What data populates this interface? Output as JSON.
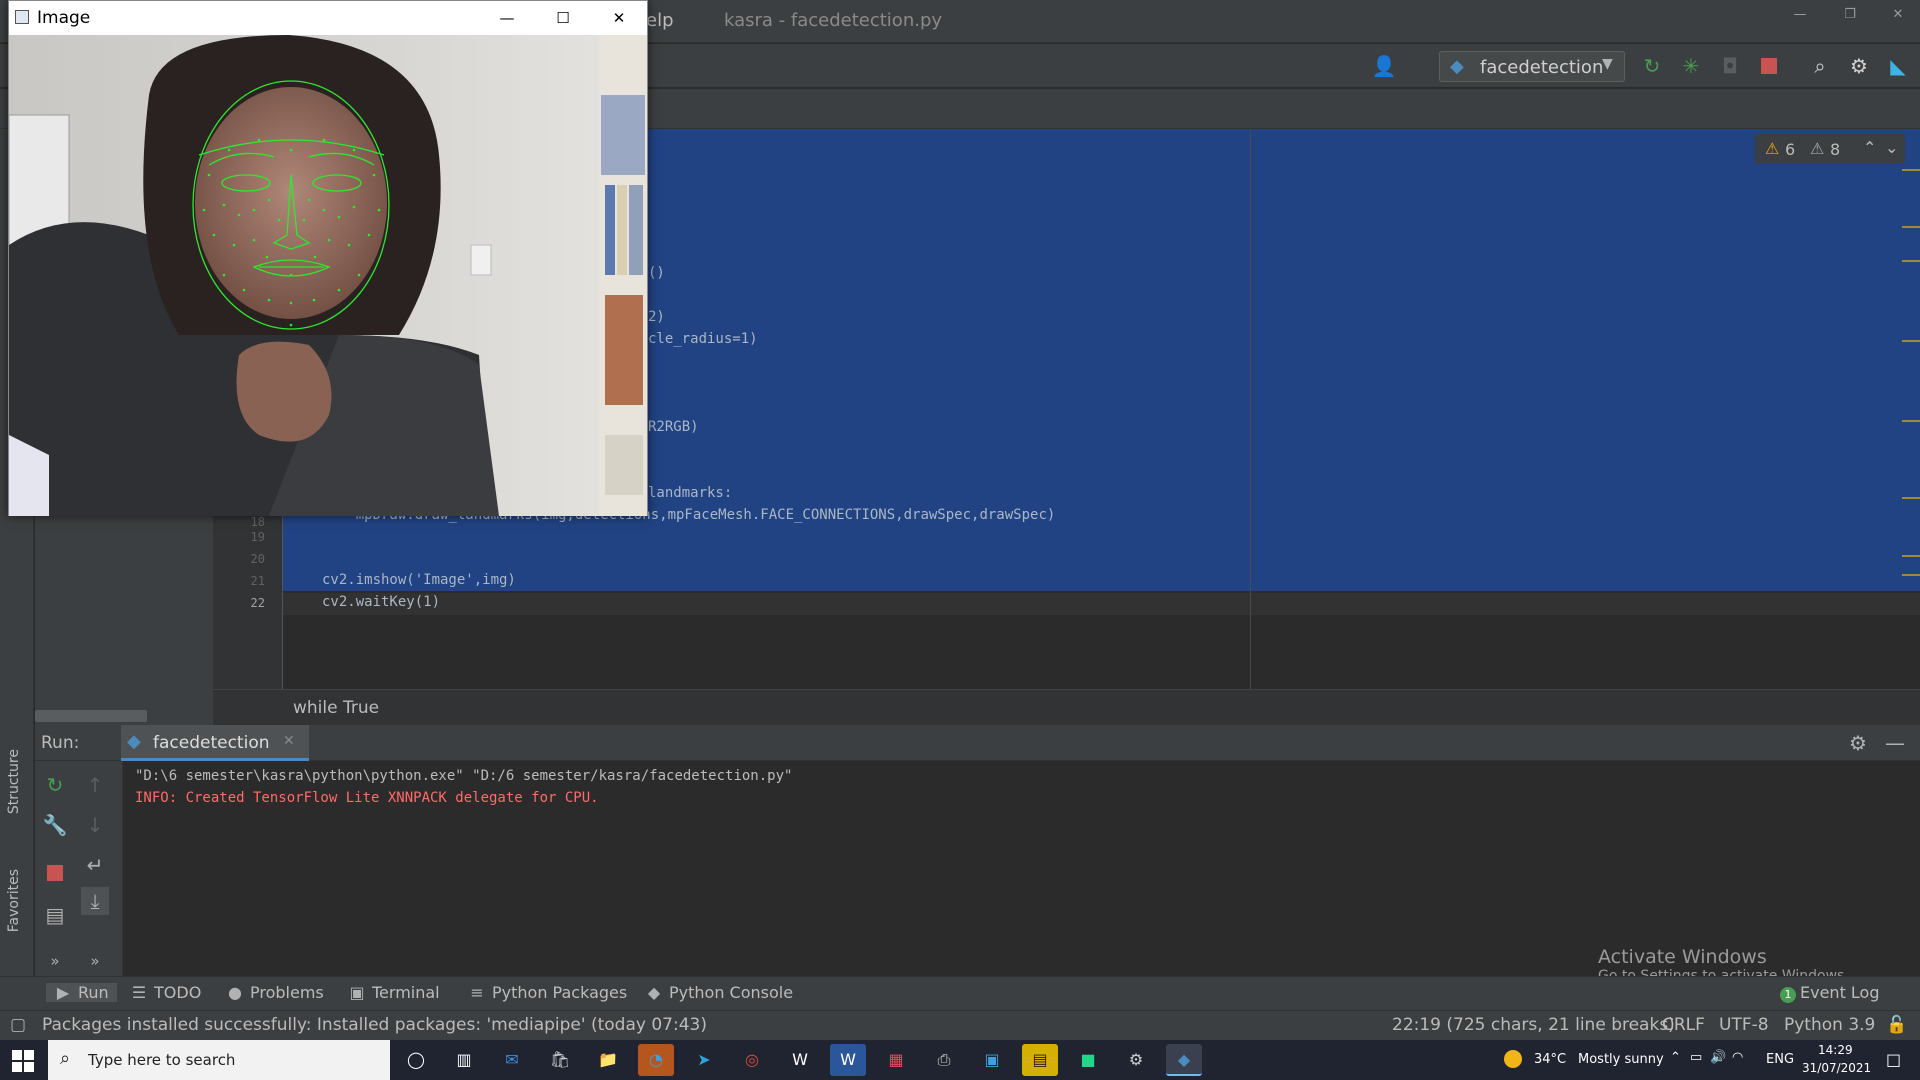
{
  "ide": {
    "menu_fragment": "elp",
    "window_title": "kasra - facedetection.py",
    "run_config": "facedetection",
    "warnings_a": "6",
    "warnings_b": "8"
  },
  "editor": {
    "visible_code": [
      {
        "text": "()",
        "line": null
      },
      {
        "text": "2)",
        "line": null
      },
      {
        "text": "cle_radius=1)",
        "line": null
      },
      {
        "text": "R2RGB)",
        "line": null
      },
      {
        "text": "landmarks:",
        "line": null
      },
      {
        "text": "    mpDraw.draw_landmarks(img,detections,mpFaceMesh.FACE_CONNECTIONS,drawSpec,drawSpec)",
        "line": "18"
      },
      {
        "text": "",
        "line": "19"
      },
      {
        "text": "",
        "line": "20"
      },
      {
        "text": "cv2.imshow('Image',img)",
        "line": "21"
      },
      {
        "text": "cv2.waitKey(1)",
        "line": "22"
      }
    ],
    "breadcrumb": "while True"
  },
  "run_panel": {
    "label": "Run:",
    "tab": "facedetection",
    "console": [
      {
        "text": "\"D:\\6 semester\\kasra\\python\\python.exe\" \"D:/6 semester/kasra/facedetection.py\"",
        "color": "#bbbbbb"
      },
      {
        "text": "INFO: Created TensorFlow Lite XNNPACK delegate for CPU.",
        "color": "#ff6b68"
      }
    ]
  },
  "side_stripe": {
    "structure": "Structure",
    "favorites": "Favorites"
  },
  "tool_tabs": {
    "run": "Run",
    "todo": "TODO",
    "problems": "Problems",
    "terminal": "Terminal",
    "python_packages": "Python Packages",
    "python_console": "Python Console",
    "event_log": "Event Log",
    "event_log_count": "1"
  },
  "status": {
    "message": "Packages installed successfully: Installed packages: 'mediapipe' (today 07:43)",
    "position": "22:19 (725 chars, 21 line breaks)",
    "line_sep": "CRLF",
    "encoding": "UTF-8",
    "interpreter": "Python 3.9"
  },
  "watermark": {
    "line1": "Activate Windows",
    "line2": "Go to Settings to activate Windows."
  },
  "image_window": {
    "title": "Image"
  },
  "taskbar": {
    "search_placeholder": "Type here to search",
    "weather_temp": "34°C",
    "weather_text": "Mostly sunny",
    "lang": "ENG",
    "time": "14:29",
    "date": "31/07/2021"
  },
  "colors": {
    "selection": "#214283",
    "accent": "#4a88c7",
    "run_green": "#499c54",
    "stop_red": "#c75450",
    "landmark_green": "#2ee82e"
  }
}
